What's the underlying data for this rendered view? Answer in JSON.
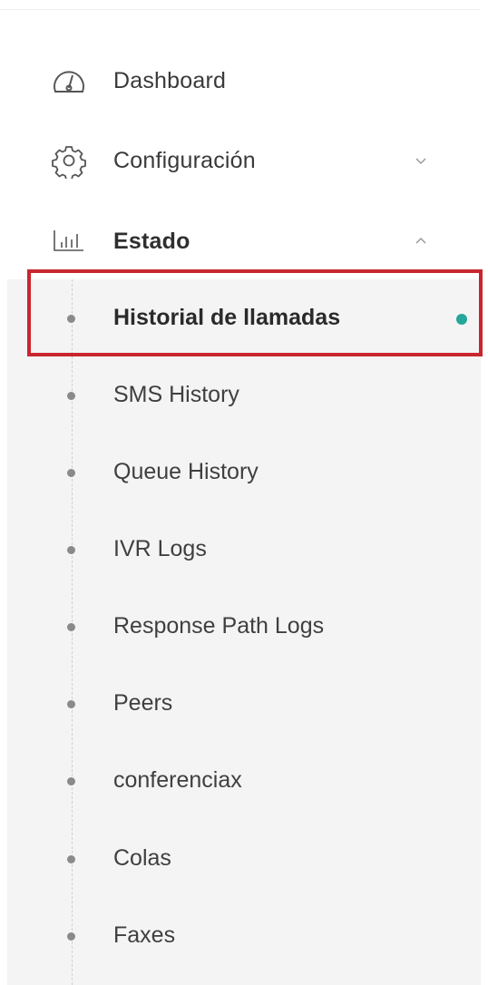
{
  "menu": {
    "items": [
      {
        "label": "Dashboard",
        "icon": "dashboard-gauge-icon"
      },
      {
        "label": "Configuración",
        "icon": "gear-icon",
        "chevron": "chevron-down-icon"
      },
      {
        "label": "Estado",
        "icon": "bar-chart-icon",
        "chevron": "chevron-up-icon",
        "expanded": true
      }
    ],
    "submenu": [
      {
        "label": "Historial de llamadas",
        "active": true
      },
      {
        "label": "SMS History"
      },
      {
        "label": "Queue History"
      },
      {
        "label": "IVR Logs"
      },
      {
        "label": "Response Path Logs"
      },
      {
        "label": "Peers"
      },
      {
        "label": "conferenciax"
      },
      {
        "label": "Colas"
      },
      {
        "label": "Faxes"
      }
    ]
  },
  "colors": {
    "active_indicator": "#26a69a",
    "highlight_border": "#c8262f",
    "submenu_background": "#f4f4f4"
  }
}
